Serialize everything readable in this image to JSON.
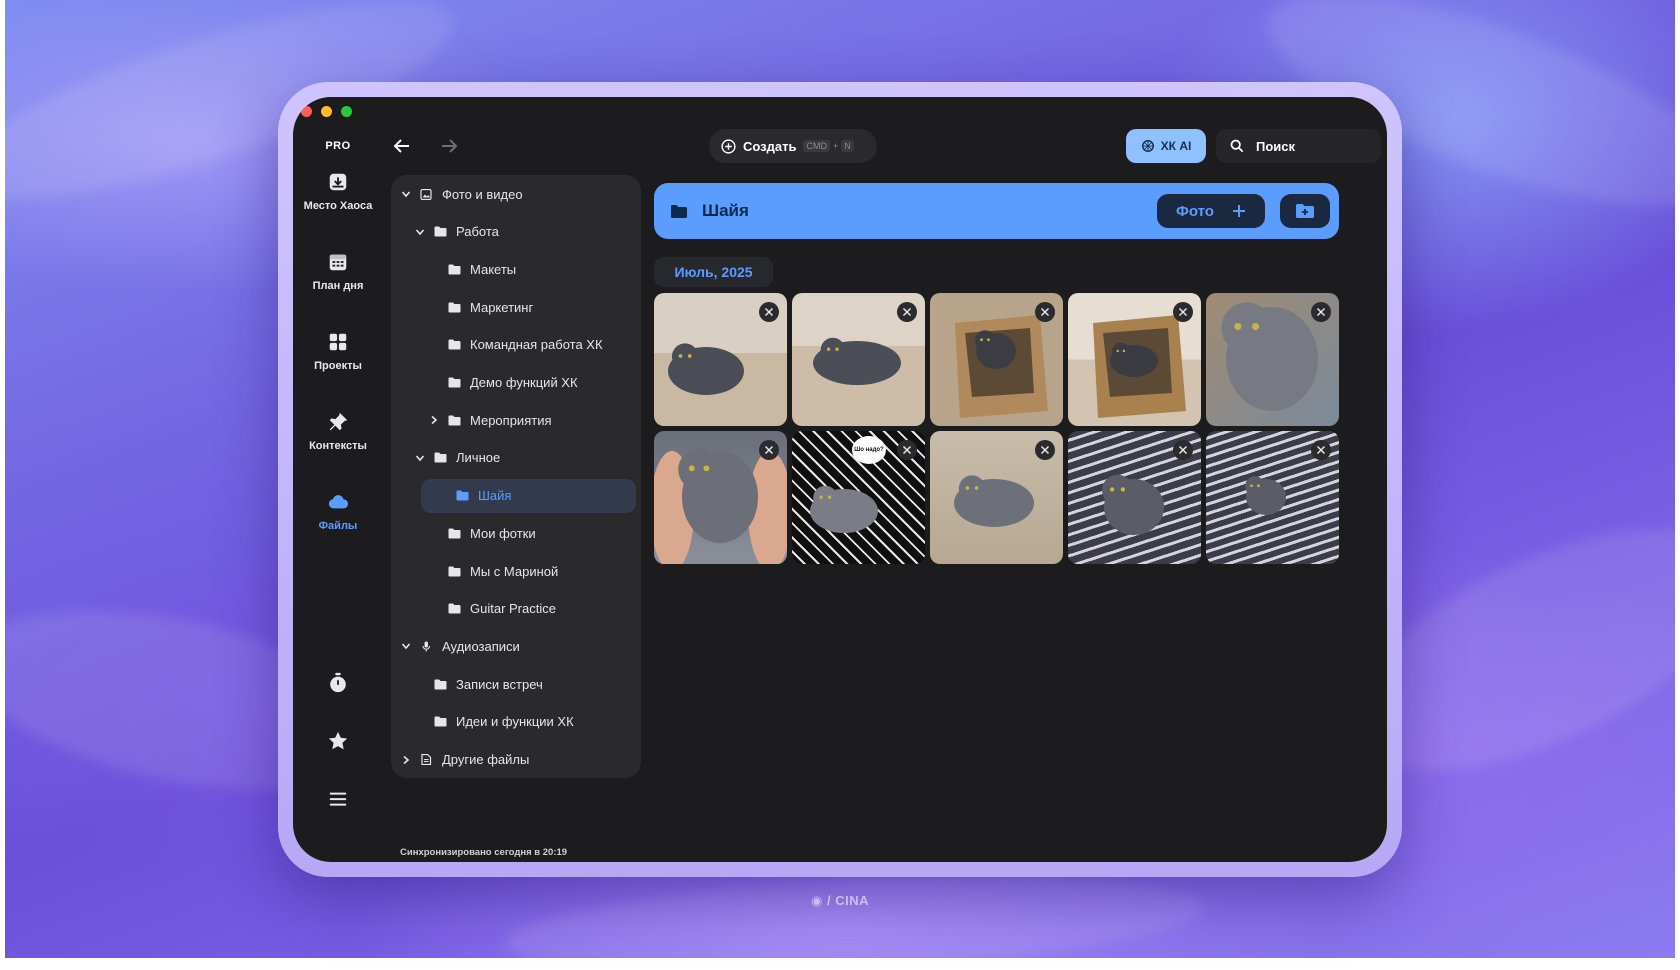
{
  "window": {
    "badge": "PRO"
  },
  "rail": {
    "items": [
      {
        "label": "Место Хаоса",
        "icon": "inbox-tray-icon"
      },
      {
        "label": "План дня",
        "icon": "calendar-icon"
      },
      {
        "label": "Проекты",
        "icon": "grid-icon"
      },
      {
        "label": "Контексты",
        "icon": "pin-icon"
      },
      {
        "label": "Файлы",
        "icon": "cloud-icon",
        "active": true
      }
    ],
    "bottom": [
      "timer-icon",
      "star-icon",
      "menu-icon"
    ]
  },
  "toolbar": {
    "create_label": "Создать",
    "shortcut_cmd": "CMD",
    "shortcut_plus": "+",
    "shortcut_key": "N",
    "ai_label": "ХК AI",
    "search_placeholder": "Поиск"
  },
  "tree": [
    {
      "label": "Фото и видео",
      "level": 0,
      "expanded": true,
      "icon": "image-icon"
    },
    {
      "label": "Работа",
      "level": 1,
      "expanded": true
    },
    {
      "label": "Макеты",
      "level": 2
    },
    {
      "label": "Маркетинг",
      "level": 2
    },
    {
      "label": "Командная работа ХК",
      "level": 2
    },
    {
      "label": "Демо функций ХК",
      "level": 2
    },
    {
      "label": "Мероприятия",
      "level": 2,
      "collapsed": true
    },
    {
      "label": "Личное",
      "level": 1,
      "expanded": true
    },
    {
      "label": "Шайя",
      "level": 2,
      "selected": true
    },
    {
      "label": "Мои фотки",
      "level": 2
    },
    {
      "label": "Мы с Мариной",
      "level": 2
    },
    {
      "label": "Guitar Practice",
      "level": 2
    },
    {
      "label": "Аудиозаписи",
      "level": 0,
      "expanded": true,
      "icon": "microphone-icon"
    },
    {
      "label": "Записи встреч",
      "level": 1
    },
    {
      "label": "Идеи и функции ХК",
      "level": 1
    },
    {
      "label": "Другие файлы",
      "level": 0,
      "collapsed": true,
      "icon": "document-icon"
    }
  ],
  "folder": {
    "title": "Шайя",
    "photo_button": "Фото",
    "date_group": "Июль, 2025",
    "photos": [
      {
        "desc": "grey cat lying on tile floor"
      },
      {
        "desc": "grey cat on back on tile floor"
      },
      {
        "desc": "cat inside paper bag"
      },
      {
        "desc": "cat in paper bag against wall"
      },
      {
        "desc": "cat close-up face"
      },
      {
        "desc": "cat held in hands"
      },
      {
        "desc": "cat on leaf-pattern blanket",
        "bubble": "Шо надо?"
      },
      {
        "desc": "cat stretched on floor"
      },
      {
        "desc": "cat on striped bed"
      },
      {
        "desc": "cat on striped bed, wide"
      }
    ]
  },
  "status": {
    "sync_text": "Синхронизировано сегодня в 20:19"
  },
  "watermark": "/ CINA",
  "colors": {
    "accent": "#5b9cff",
    "screen": "#1c1c1e",
    "panel": "#2a2a2d"
  }
}
